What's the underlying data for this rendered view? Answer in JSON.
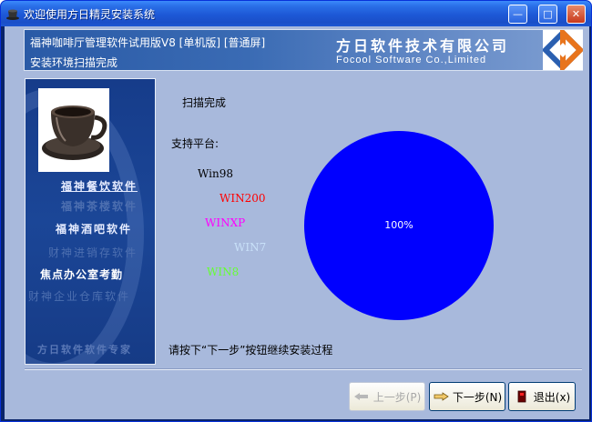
{
  "window": {
    "title": "欢迎使用方日精灵安装系统",
    "controls": {
      "minimize": "—",
      "maximize": "□",
      "close": "✕"
    }
  },
  "header": {
    "product": "福神咖啡厅管理软件试用版V8    [单机版]    [普通屏]",
    "status": "安装环境扫描完成",
    "company_cn": "方日软件技术有限公司",
    "company_en": "Focool Software Co.,Limited",
    "logo_colors": [
      "#2a5fb0",
      "#e8741c"
    ]
  },
  "sidebar": {
    "items": [
      "福神餐饮软件",
      "福神茶楼软件",
      "福神酒吧软件",
      "财神进销存软件",
      "焦点办公室考勤",
      "财神企业仓库软件",
      "方日软件软件专家"
    ]
  },
  "main": {
    "scan_done": "扫描完成",
    "support_label": "支持平台:",
    "platforms": [
      {
        "name": "Win98",
        "color": "#000000"
      },
      {
        "name": "WIN200",
        "color": "#ff0000"
      },
      {
        "name": "WINXP",
        "color": "#ff00ff"
      },
      {
        "name": "WIN7",
        "color": "#c8e0f8"
      },
      {
        "name": "WIN8",
        "color": "#66ff33"
      }
    ],
    "instruction": "请按下“下一步”按钮继续安装过程"
  },
  "chart_data": {
    "type": "pie",
    "values": [
      100
    ],
    "labels": [
      "100%"
    ],
    "colors": [
      "#0000ff"
    ]
  },
  "buttons": {
    "prev": "上一步(P)",
    "next": "下一步(N)",
    "exit": "退出(x)"
  }
}
